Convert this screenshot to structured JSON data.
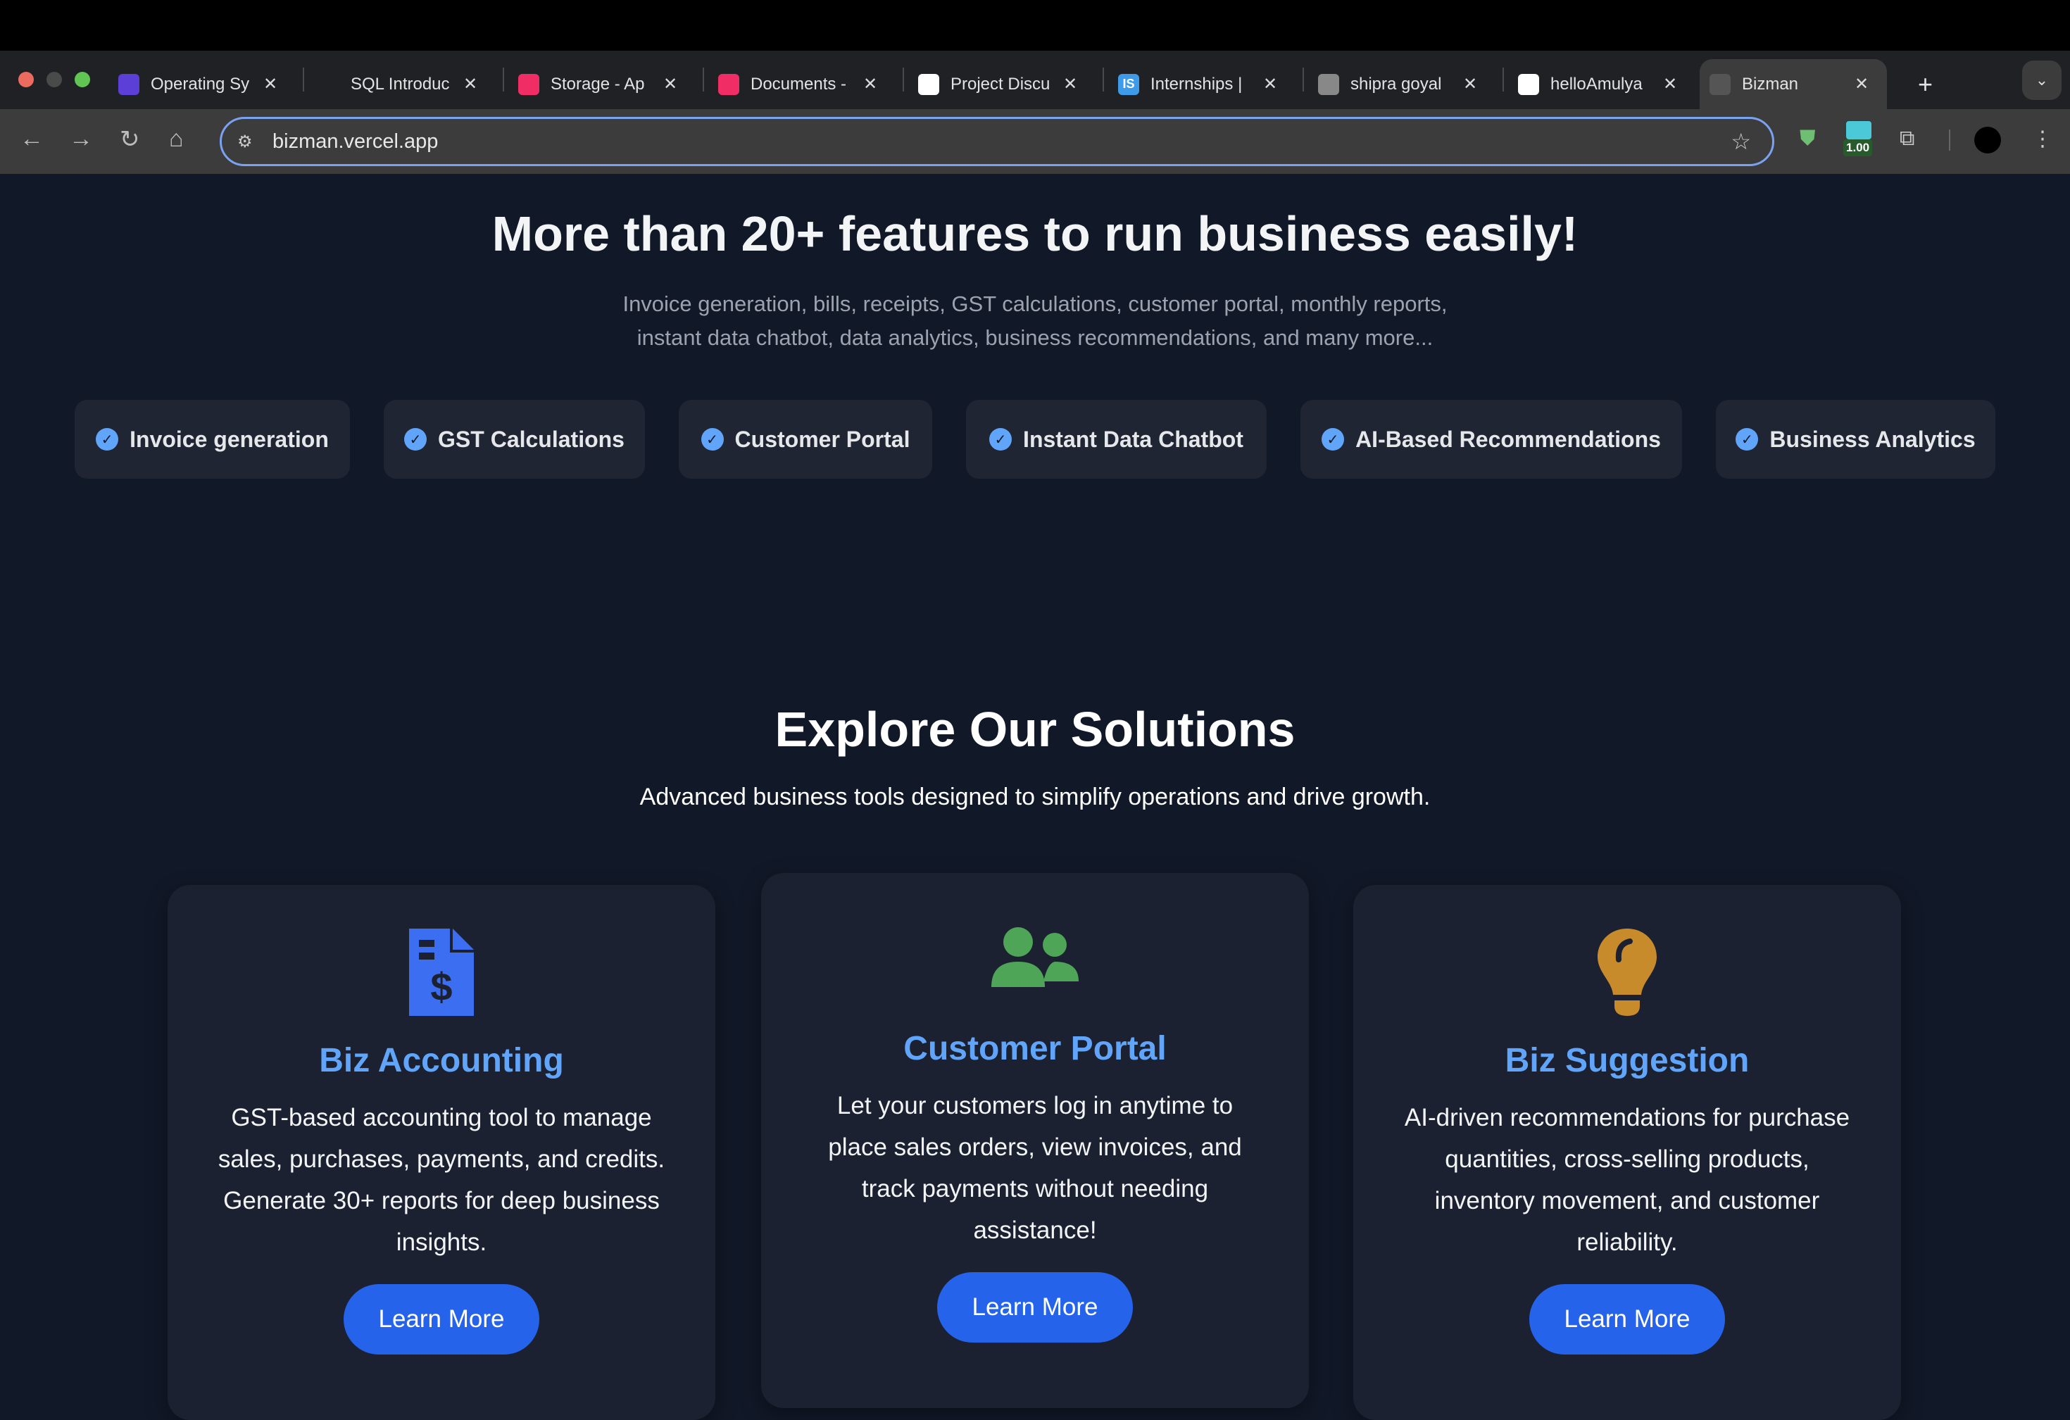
{
  "browser": {
    "tabs": [
      {
        "title": "Operating Sy",
        "icon": "code-icon",
        "color": "#5b3fd6"
      },
      {
        "title": "SQL Introduc",
        "icon": "sparkle-icon",
        "color": "#202124"
      },
      {
        "title": "Storage - Ap",
        "icon": "appwrite-icon",
        "color": "#f02e65"
      },
      {
        "title": "Documents -",
        "icon": "appwrite-icon",
        "color": "#f02e65"
      },
      {
        "title": "Project Discu",
        "icon": "openai-icon",
        "color": "#ffffff"
      },
      {
        "title": "Internships |",
        "icon": "is-icon",
        "color": "#3d9be9",
        "badge": "IS"
      },
      {
        "title": "shipra goyal",
        "icon": "globe-icon",
        "color": "#888888"
      },
      {
        "title": "helloAmulya",
        "icon": "github-icon",
        "color": "#ffffff"
      },
      {
        "title": "Bizman",
        "icon": "bizman-icon",
        "color": "#555555",
        "active": true
      }
    ],
    "url": "bizman.vercel.app",
    "extension_badge": "1.00"
  },
  "features": {
    "title": "More than 20+ features to run business easily!",
    "subtitle_line1": "Invoice generation, bills, receipts, GST calculations, customer portal, monthly reports,",
    "subtitle_line2": "instant data chatbot, data analytics, business recommendations, and many more...",
    "pills": [
      "Invoice generation",
      "GST Calculations",
      "Customer Portal",
      "Instant Data Chatbot",
      "AI-Based Recommendations",
      "Business Analytics"
    ]
  },
  "solutions": {
    "title": "Explore Our Solutions",
    "subtitle": "Advanced business tools designed to simplify operations and drive growth.",
    "cards": [
      {
        "icon": "invoice-dollar-icon",
        "color": "#3b6ef0",
        "title": "Biz Accounting",
        "body": "GST-based accounting tool to manage sales, purchases, payments, and credits. Generate 30+ reports for deep business insights.",
        "button": "Learn More"
      },
      {
        "icon": "users-icon",
        "color": "#4ea457",
        "title": "Customer Portal",
        "body": "Let your customers log in anytime to place sales orders, view invoices, and track payments without needing assistance!",
        "button": "Learn More"
      },
      {
        "icon": "lightbulb-icon",
        "color": "#c88b2c",
        "title": "Biz Suggestion",
        "body": "AI-driven recommendations for purchase quantities, cross-selling products, inventory movement, and customer reliability.",
        "button": "Learn More"
      }
    ]
  }
}
